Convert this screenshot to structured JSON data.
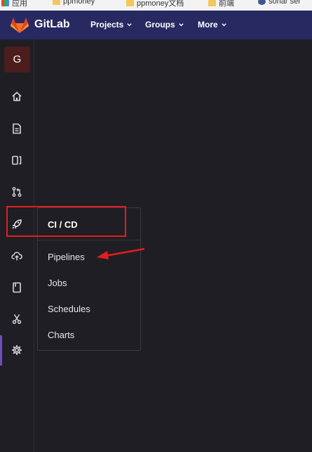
{
  "bookmarks": [
    {
      "label": "应用",
      "icon": "apps-grid-icon"
    },
    {
      "label": "ppmoney",
      "icon": "folder-icon"
    },
    {
      "label": "ppmoney文档",
      "icon": "folder-icon"
    },
    {
      "label": "前端",
      "icon": "folder-icon"
    },
    {
      "label": "sonar ser",
      "icon": "sonar-icon"
    }
  ],
  "navbar": {
    "brand": "GitLab",
    "menus": [
      {
        "label": "Projects"
      },
      {
        "label": "Groups"
      },
      {
        "label": "More"
      }
    ]
  },
  "sidebar": {
    "avatar_letter": "G",
    "items": [
      {
        "icon": "home-icon"
      },
      {
        "icon": "document-icon"
      },
      {
        "icon": "issues-icon"
      },
      {
        "icon": "merge-request-icon"
      },
      {
        "icon": "rocket-icon"
      },
      {
        "icon": "cloud-upload-icon"
      },
      {
        "icon": "book-icon"
      },
      {
        "icon": "scissors-icon"
      },
      {
        "icon": "gear-icon"
      }
    ]
  },
  "flyout": {
    "title": "CI / CD",
    "items": [
      {
        "label": "Pipelines"
      },
      {
        "label": "Jobs"
      },
      {
        "label": "Schedules"
      },
      {
        "label": "Charts"
      }
    ]
  },
  "colors": {
    "navbar": "#292961",
    "background": "#1f1e24",
    "highlight": "#e31e1e",
    "active_indicator": "#6b4fbb"
  }
}
